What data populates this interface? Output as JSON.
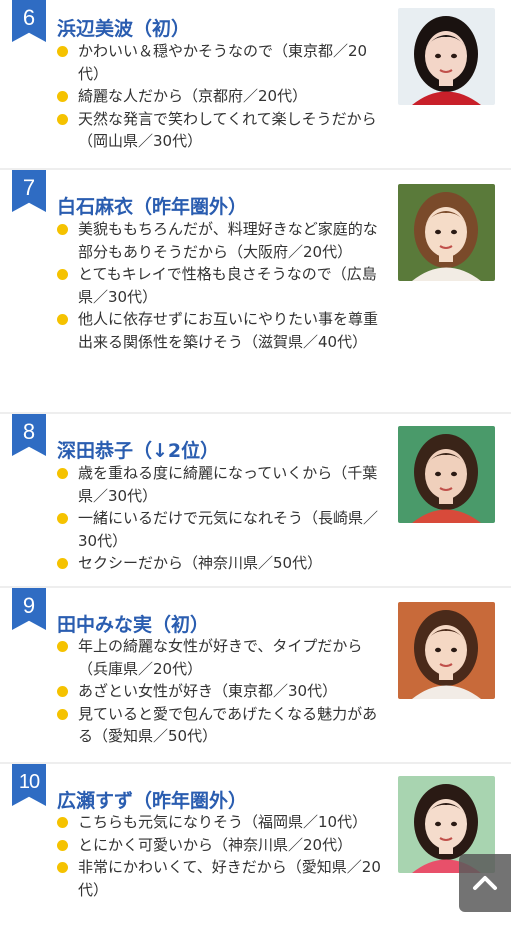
{
  "entries": [
    {
      "rank": "6",
      "name": "浜辺美波（初）",
      "reasons": [
        "かわいい＆穏やかそうなので（東京都／20代）",
        "綺麗な人だから（京都府／20代）",
        "天然な発言で笑わしてくれて楽しそうだから（岡山県／30代）"
      ],
      "photo_bg": "#e8eef2",
      "hair": "#1a1210",
      "skin": "#f3d6c8",
      "clothes": "#c8202a"
    },
    {
      "rank": "7",
      "name": "白石麻衣（昨年圏外）",
      "reasons": [
        "美貌ももちろんだが、料理好きなど家庭的な部分もありそうだから（大阪府／20代）",
        "とてもキレイで性格も良さそうなので（広島県／30代）",
        "他人に依存せずにお互いにやりたい事を尊重出来る関係性を築けそう（滋賀県／40代）"
      ],
      "photo_bg": "#5a7a3a",
      "hair": "#7a4a2a",
      "skin": "#f5dcc8",
      "clothes": "#f2ece4"
    },
    {
      "rank": "8",
      "name": "深田恭子（↓2位）",
      "reasons": [
        "歳を重ねる度に綺麗になっていくから（千葉県／30代）",
        "一緒にいるだけで元気になれそう（長崎県／30代）",
        "セクシーだから（神奈川県／50代）"
      ],
      "photo_bg": "#4a9a6a",
      "hair": "#3a2418",
      "skin": "#f0d0bc",
      "clothes": "#d84a3a"
    },
    {
      "rank": "9",
      "name": "田中みな実（初）",
      "reasons": [
        "年上の綺麗な女性が好きで、タイプだから（兵庫県／20代）",
        "あざとい女性が好き（東京都／30代）",
        "見ていると愛で包んであげたくなる魅力がある（愛知県／50代）"
      ],
      "photo_bg": "#c86a3a",
      "hair": "#4a2a1a",
      "skin": "#f5d8c4",
      "clothes": "#f2ece6"
    },
    {
      "rank": "10",
      "name": "広瀬すず（昨年圏外）",
      "reasons": [
        "こちらも元気になりそう（福岡県／10代）",
        "とにかく可愛いから（神奈川県／20代）",
        "非常にかわいくて、好きだから（愛知県／20代）"
      ],
      "photo_bg": "#a8d4b0",
      "hair": "#2a1a14",
      "skin": "#f5dccc",
      "clothes": "#e8506a"
    }
  ],
  "colors": {
    "accent_blue": "#2f6cc3",
    "name_blue": "#2a5db0",
    "bullet_yellow": "#f5c200"
  },
  "scroll_top_icon": "chevron-up-icon"
}
